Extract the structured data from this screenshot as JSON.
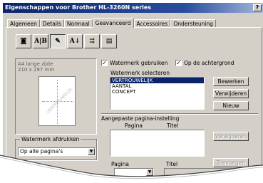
{
  "window": {
    "title": "Eigenschappen voor Brother HL-3260N series",
    "help": "?"
  },
  "tabs": [
    "Algemeen",
    "Details",
    "Normaal",
    "Geavanceerd",
    "Accessoires",
    "Ondersteuning"
  ],
  "active_tab": "Geavanceerd",
  "iconbar": [
    {
      "name": "print-quality-icon",
      "glyph": "◙"
    },
    {
      "name": "duplex-icon",
      "glyph": "A|B"
    },
    {
      "name": "watermark-icon",
      "glyph": "✎"
    },
    {
      "name": "page-setting-icon",
      "glyph": "A↓"
    },
    {
      "name": "device-options-icon",
      "glyph": "⇉"
    },
    {
      "name": "other-options-icon",
      "glyph": "▤"
    }
  ],
  "preview": {
    "line1": "A4 lange zijde",
    "line2": "210 x 297 mm",
    "watermark_text": "VERTROUWELIJK"
  },
  "watermark_print": {
    "legend": "Watermerk afdrukken",
    "value": "Op alle pagina's"
  },
  "options": {
    "use_watermark": "Watermerk gebruiken",
    "background": "Op de achtergrond"
  },
  "select_watermark": {
    "label": "Watermerk selecteren",
    "items": [
      "VERTROUWELIJK",
      "AANTAL",
      "CONCEPT"
    ],
    "selected": "VERTROUWELIJK"
  },
  "buttons": {
    "edit": "Bewerken",
    "delete": "Verwijderen",
    "new": "Nieuw",
    "delete2": "Verwijderen",
    "options2": "Toevoegen"
  },
  "custom_page": {
    "label": "Aangepaste pagina-instelling",
    "col_page": "Pagina",
    "col_title": "Titel"
  },
  "bottom": {
    "page_label": "Pagina",
    "title_label": "Titel"
  }
}
